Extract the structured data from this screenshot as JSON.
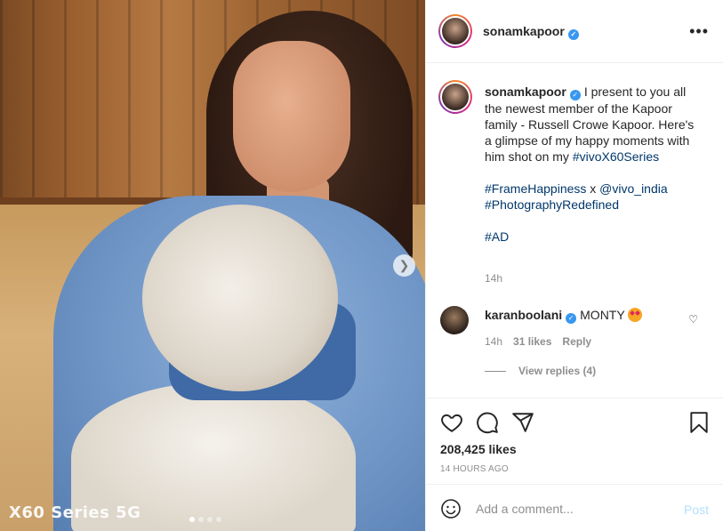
{
  "media": {
    "overlay_text": "X60 Series 5G",
    "next_icon": "chevron-right-icon",
    "carousel_dots": 4,
    "carousel_active": 1
  },
  "header": {
    "username": "sonamkapoor",
    "verified_icon": "verified-badge-icon",
    "more_icon": "more-options-icon"
  },
  "caption": {
    "username": "sonamkapoor",
    "text": "I present to you all the newest member of the Kapoor family - Russell Crowe Kapoor. Here's a glimpse of my happy moments with him shot on my",
    "hashtag1": "#vivoX60Series",
    "hashtag2": "#FrameHappiness",
    "connector": "x",
    "mention": "@vivo_india",
    "hashtag3": "#PhotographyRedefined",
    "hashtag4": "#AD",
    "time": "14h"
  },
  "reply": {
    "username": "karanboolani",
    "text": "MONTY",
    "emoji": "heart-eyes-emoji",
    "time": "14h",
    "likes": "31 likes",
    "reply_label": "Reply",
    "view_replies": "View replies (4)"
  },
  "actions": {
    "like_icon": "heart-icon",
    "comment_icon": "comment-icon",
    "share_icon": "share-icon",
    "save_icon": "bookmark-icon"
  },
  "likes": "208,425 likes",
  "date": "14 HOURS AGO",
  "add_comment": {
    "placeholder": "Add a comment...",
    "post_label": "Post",
    "emoji_icon": "smiley-icon"
  },
  "colors": {
    "link": "#00376b",
    "verified": "#3897f0",
    "post_disabled": "#b2dffc",
    "muted": "#8e8e8e"
  }
}
